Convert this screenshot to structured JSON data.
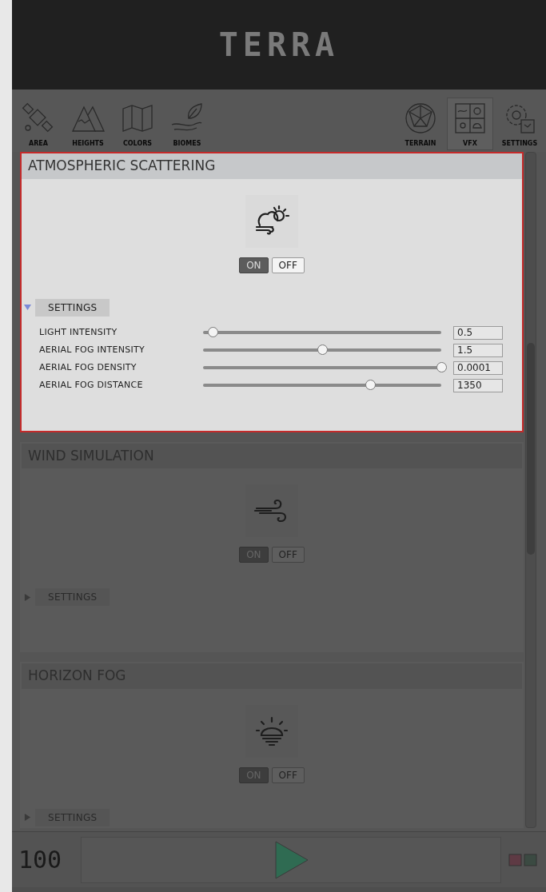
{
  "logo": "TERRA",
  "toolbar": {
    "left": [
      {
        "label": "AREA",
        "selected": false
      },
      {
        "label": "HEIGHTS",
        "selected": false
      },
      {
        "label": "COLORS",
        "selected": false
      },
      {
        "label": "BIOMES",
        "selected": false
      }
    ],
    "right": [
      {
        "label": "TERRAIN",
        "selected": false
      },
      {
        "label": "VFX",
        "selected": true
      },
      {
        "label": "SETTINGS",
        "selected": false
      }
    ]
  },
  "sections": [
    {
      "title": "ATMOSPHERIC SCATTERING",
      "highlighted": true,
      "toggle": [
        {
          "label": "ON",
          "selected": true
        },
        {
          "label": "OFF",
          "selected": false
        }
      ],
      "settings": {
        "label": "SETTINGS",
        "expanded": true,
        "rows": [
          {
            "label": "LIGHT INTENSITY",
            "level": 0.04,
            "value": "0.5"
          },
          {
            "label": "AERIAL FOG INTENSITY",
            "level": 0.5,
            "value": "1.5"
          },
          {
            "label": "AERIAL FOG DENSITY",
            "level": 1.0,
            "value": "0.0001"
          },
          {
            "label": "AERIAL FOG DISTANCE",
            "level": 0.7,
            "value": "1350"
          }
        ]
      }
    },
    {
      "title": "WIND SIMULATION",
      "highlighted": false,
      "toggle": [
        {
          "label": "ON",
          "selected": true
        },
        {
          "label": "OFF",
          "selected": false
        }
      ],
      "settings": {
        "label": "SETTINGS",
        "expanded": false
      }
    },
    {
      "title": "HORIZON FOG",
      "highlighted": false,
      "toggle": [
        {
          "label": "ON",
          "selected": true
        },
        {
          "label": "OFF",
          "selected": false
        }
      ],
      "settings": {
        "label": "SETTINGS",
        "expanded": false
      }
    }
  ],
  "bottom": {
    "counter": "100"
  }
}
